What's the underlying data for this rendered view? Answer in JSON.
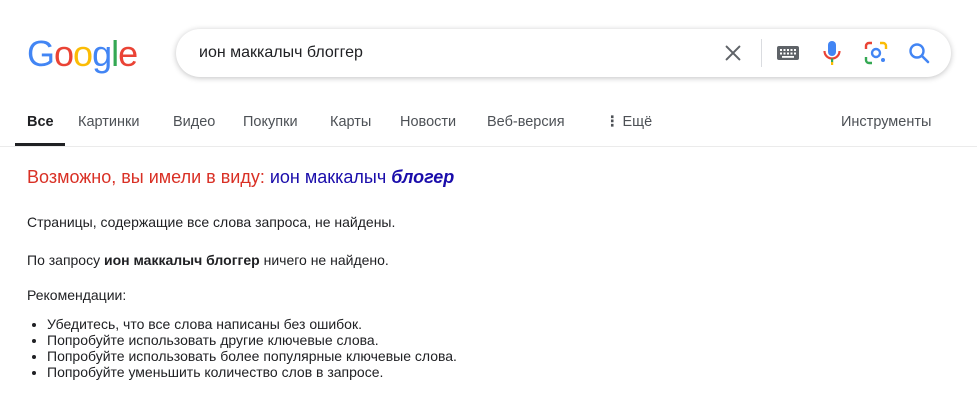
{
  "header": {
    "logo": "Google",
    "search_query": "ион маккалыч блоггер",
    "icons": [
      "clear-icon",
      "keyboard-icon",
      "microphone-icon",
      "lens-icon",
      "search-icon"
    ]
  },
  "tabs": [
    {
      "label": "Все",
      "active": true
    },
    {
      "label": "Картинки"
    },
    {
      "label": "Видео"
    },
    {
      "label": "Покупки"
    },
    {
      "label": "Карты"
    },
    {
      "label": "Новости"
    },
    {
      "label": "Веб-версия"
    },
    {
      "label": "Ещё"
    }
  ],
  "tools_label": "Инструменты",
  "spelling": {
    "prefix": "Возможно, вы имели в виду:",
    "suggest_normal": "ион маккалыч",
    "suggest_bold": "блогер"
  },
  "results": {
    "no_pages": "Страницы, содержащие все слова запроса, не найдены.",
    "no_results_prefix": "По запросу",
    "no_results_query": "ион маккалыч блоггер",
    "no_results_suffix": "ничего не найдено.",
    "recommendations_title": "Рекомендации:",
    "recommendations": [
      "Убедитесь, что все слова написаны без ошибок.",
      "Попробуйте использовать другие ключевые слова.",
      "Попробуйте использовать более популярные ключевые слова.",
      "Попробуйте уменьшить количество слов в запросе."
    ]
  },
  "colors": {
    "accent_link": "#1a0dab",
    "spell_prefix": "#d93025",
    "logo_blue": "#4285F4",
    "logo_red": "#EA4335",
    "logo_yellow": "#FBBC05",
    "logo_green": "#34A853"
  }
}
